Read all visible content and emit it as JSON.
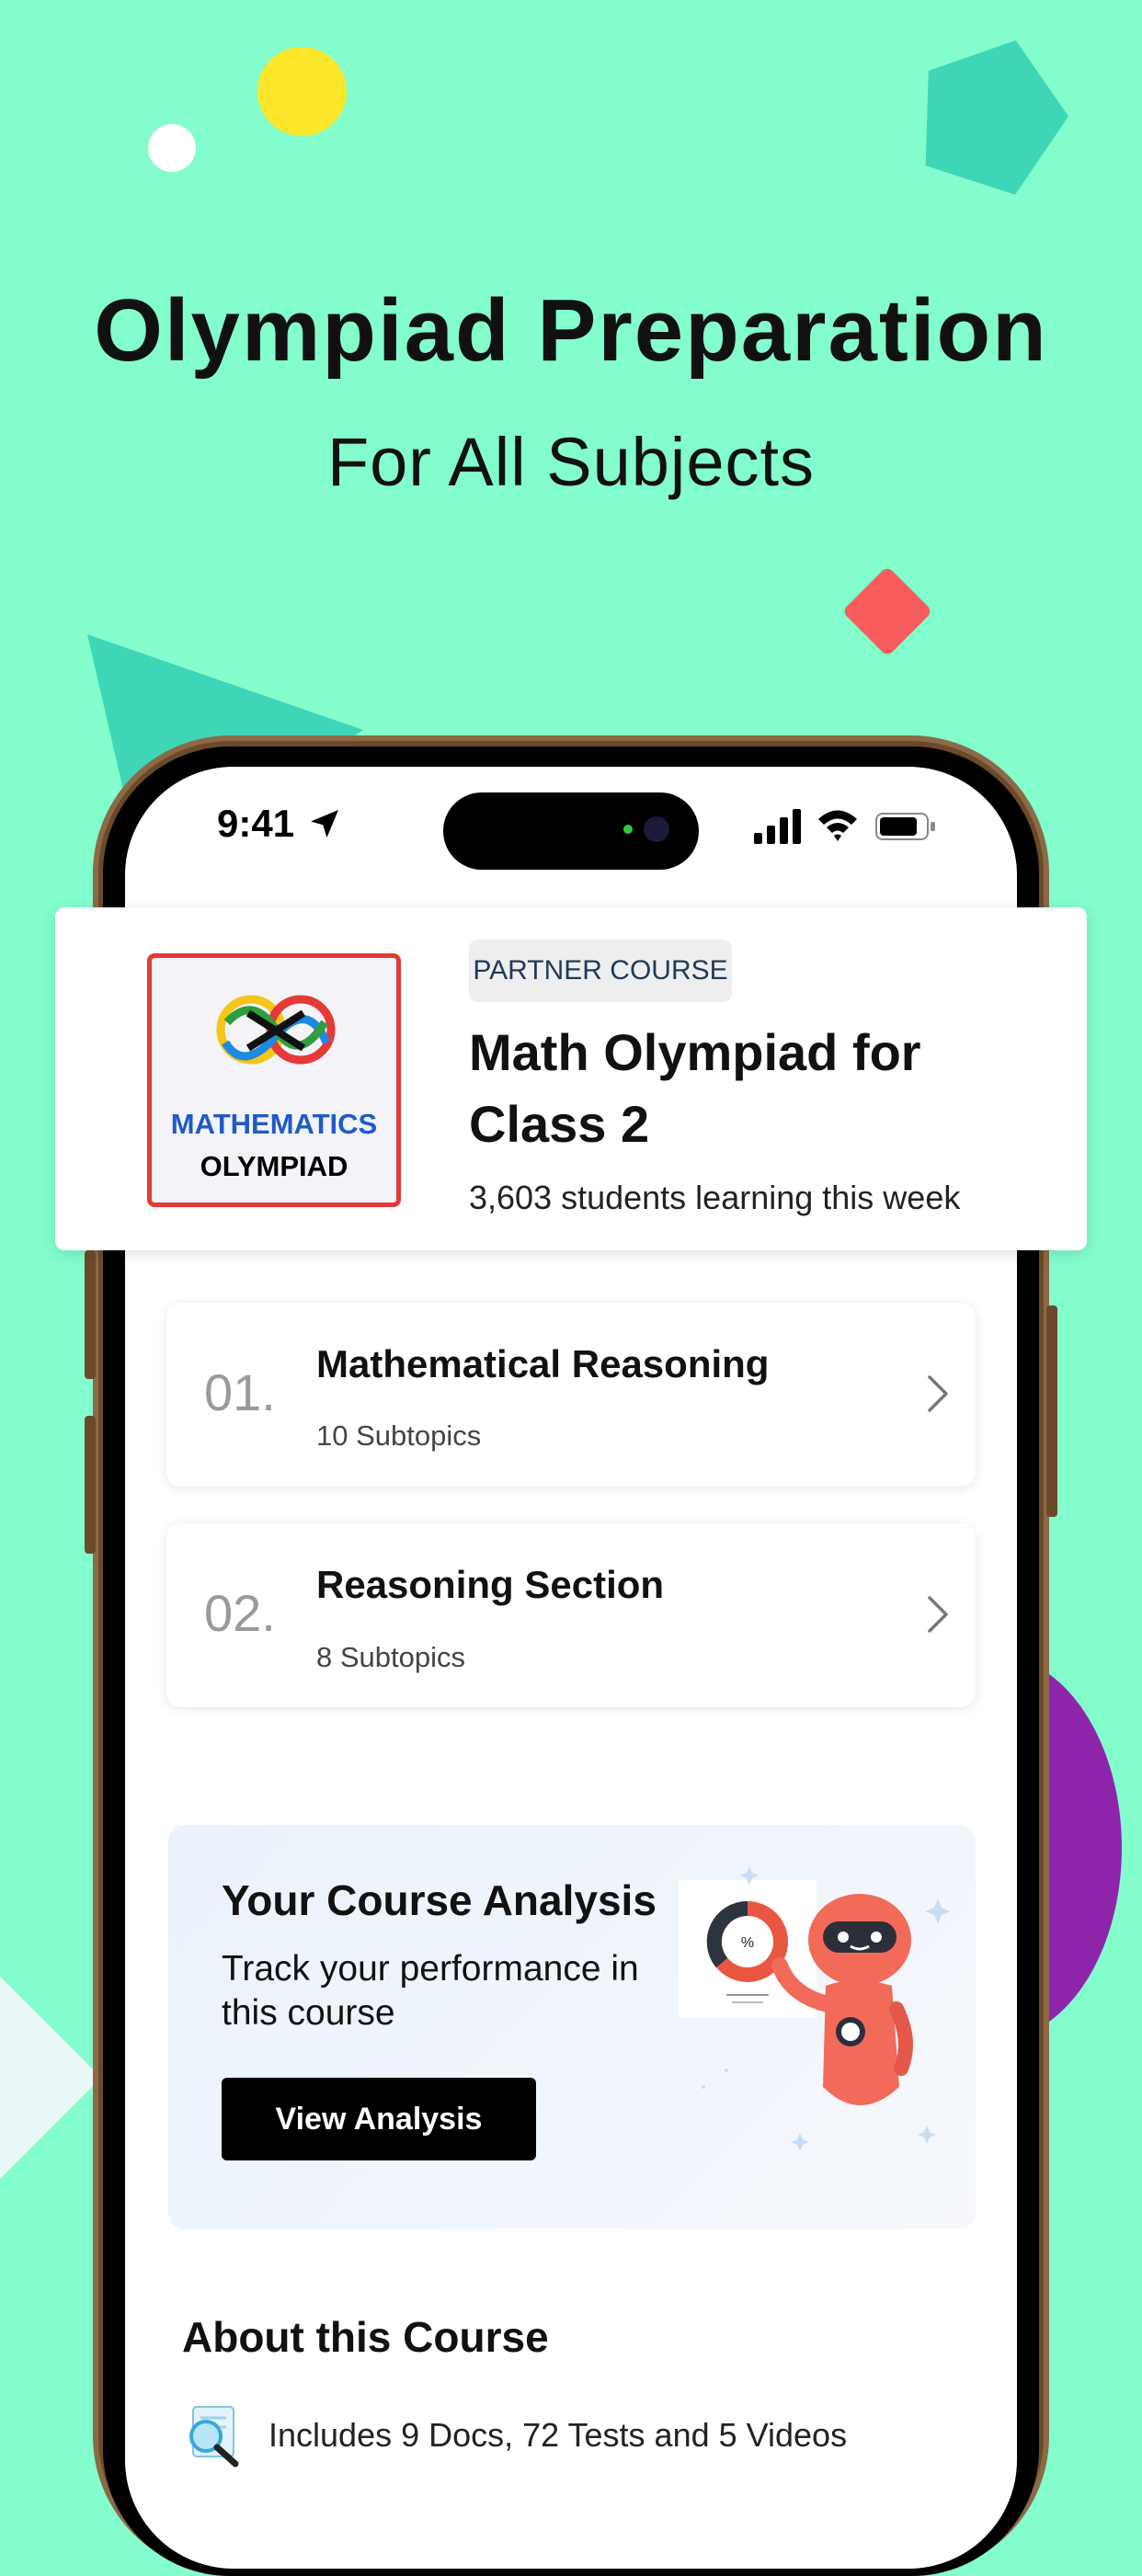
{
  "promo": {
    "headline": "Olympiad Preparation",
    "subline": "For All Subjects"
  },
  "status_bar": {
    "time": "9:41"
  },
  "course": {
    "logo_line1": "MATHEMATICS",
    "logo_line2": "OLYMPIAD",
    "badge": "PARTNER COURSE",
    "title": "Math Olympiad for Class 2",
    "students": "3,603 students learning this week"
  },
  "topics": [
    {
      "number": "01.",
      "title": "Mathematical Reasoning",
      "subtopics": "10 Subtopics"
    },
    {
      "number": "02.",
      "title": "Reasoning Section",
      "subtopics": "8 Subtopics"
    }
  ],
  "analysis": {
    "title": "Your Course Analysis",
    "description": "Track your performance in this course",
    "button_label": "View Analysis",
    "chart_symbol": "%"
  },
  "about": {
    "title": "About this Course",
    "includes": "Includes 9 Docs, 72 Tests and 5 Videos"
  },
  "colors": {
    "background": "#82FDCB",
    "accent_red": "#E53935",
    "brand_blue": "#1E5BC6",
    "button_black": "#000000"
  }
}
